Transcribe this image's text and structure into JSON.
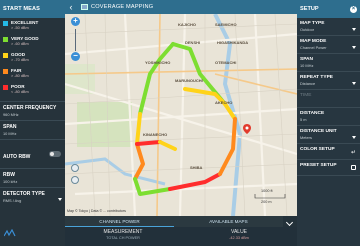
{
  "app": {
    "title": "COVERAGE MAPPING"
  },
  "left_panel": {
    "start_label": "START MEAS",
    "legend": [
      {
        "name": "EXCELLENT",
        "value": "> -50 dBm",
        "color": "#25b9e6"
      },
      {
        "name": "VERY GOOD",
        "value": "> -60 dBm",
        "color": "#7dde31"
      },
      {
        "name": "GOOD",
        "value": "> -70 dBm",
        "color": "#ffd319"
      },
      {
        "name": "FAIR",
        "value": "> -80 dBm",
        "color": "#ff8a1e"
      },
      {
        "name": "POOR",
        "value": "< -80 dBm",
        "color": "#ff2d2d"
      }
    ],
    "center_frequency": {
      "label": "CENTER FREQUENCY",
      "value": "960 MHz"
    },
    "span": {
      "label": "SPAN",
      "value": "10 MHz"
    },
    "auto_rbw": {
      "label": "AUTO RBW"
    },
    "rbw": {
      "label": "RBW",
      "value": "100 kHz"
    },
    "detector_type": {
      "label": "DETECTOR TYPE",
      "value": "RMS / Avg"
    }
  },
  "map": {
    "labels": [
      "SAEMICHO",
      "KAJICHO",
      "HIGASHIKANDA",
      "DENSHI",
      "YOSHIKICHO",
      "OTEMACHI",
      "MARUNOUCHI",
      "AKECHO",
      "KINANECHO",
      "SHIBA"
    ],
    "attribution": "Map © Tokyo | Data © ... contributors",
    "scale_m": "1000 ft",
    "scale_k": "200 m"
  },
  "bottom": {
    "tabs": [
      "CHANNEL POWER",
      "AVAILABLE MAPS"
    ],
    "table": {
      "headers": [
        "MEASUREMENT",
        "VALUE"
      ],
      "row": [
        "TOTAL CH POWER",
        "-42.33 dBm"
      ]
    }
  },
  "right_panel": {
    "title": "SETUP",
    "items": [
      {
        "label": "MAP TYPE",
        "value": "Outdoor"
      },
      {
        "label": "MAP MODE",
        "value": "Channel Power"
      },
      {
        "label": "SPAN",
        "value": "10 MHz"
      },
      {
        "label": "REPEAT TYPE",
        "value": "Distance"
      },
      {
        "label": "TIME",
        "value": ""
      },
      {
        "label": "DISTANCE",
        "value": "5 m"
      },
      {
        "label": "DISTANCE UNIT",
        "value": "Meters"
      },
      {
        "label": "COLOR SETUP",
        "value": ""
      },
      {
        "label": "PRESET SETUP",
        "value": ""
      }
    ]
  }
}
